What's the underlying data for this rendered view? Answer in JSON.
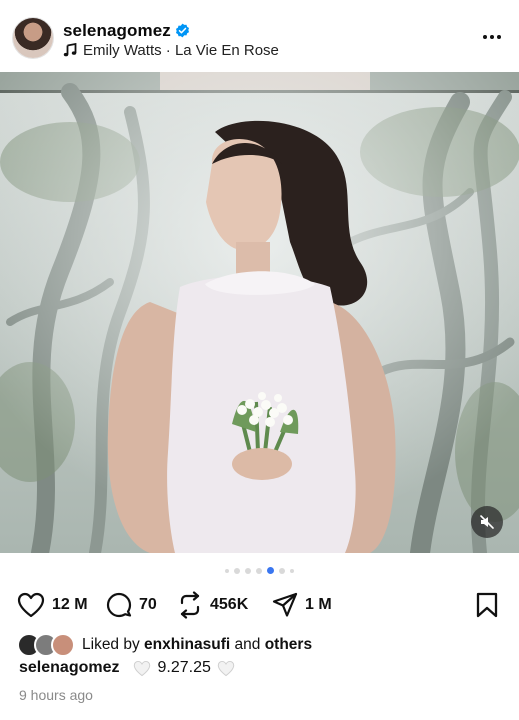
{
  "post": {
    "username": "selenagomez",
    "audio": "Emily Watts · La Vie En Rose",
    "verified": true
  },
  "media": {
    "description_icon": "woman-in-white-dress-photo",
    "carousel_total": 7,
    "carousel_active": 5,
    "muted": true
  },
  "actions": {
    "likes": "12 M",
    "comments": "70",
    "reposts": "456K",
    "shares": "1 M"
  },
  "liked_by": {
    "prefix": "Liked by",
    "user": "enxhinasufi",
    "joiner": "and",
    "others": "others"
  },
  "caption": {
    "user": "selenagomez",
    "date": "9.27.25"
  },
  "timestamp": "9 hours ago",
  "colors": {
    "accent": "#3a76f0",
    "verified": "#0095f6",
    "muted_text": "#8a8a8a"
  }
}
